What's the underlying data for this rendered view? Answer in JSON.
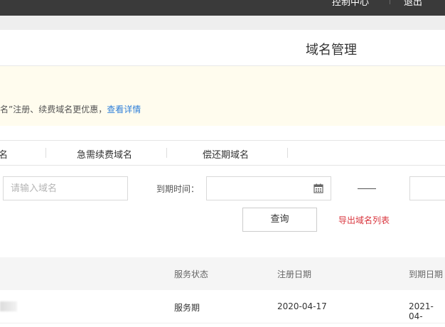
{
  "topbar": {
    "right_text": "控制中心",
    "right_text_2": "退出"
  },
  "page": {
    "title": "域名管理"
  },
  "notice": {
    "text": "名”注册、续费域名更优惠，",
    "link": "查看详情"
  },
  "tabs": [
    {
      "label": "名"
    },
    {
      "label": "急需续费域名"
    },
    {
      "label": "偿还期域名"
    }
  ],
  "filters": {
    "domain_placeholder": "请输入域名",
    "expire_label": "到期时间：",
    "query_button": "查询",
    "export_link": "导出域名列表"
  },
  "table": {
    "headers": [
      "服务状态",
      "注册日期",
      "到期日期"
    ],
    "rows": [
      {
        "status": "服务期",
        "reg_date": "2020-04-17",
        "exp_date": "2021-04-"
      }
    ]
  },
  "colors": {
    "link": "#2f7fd9",
    "danger": "#d9363e",
    "notice_bg": "#fffcee",
    "topbar": "#3a3a3a"
  }
}
